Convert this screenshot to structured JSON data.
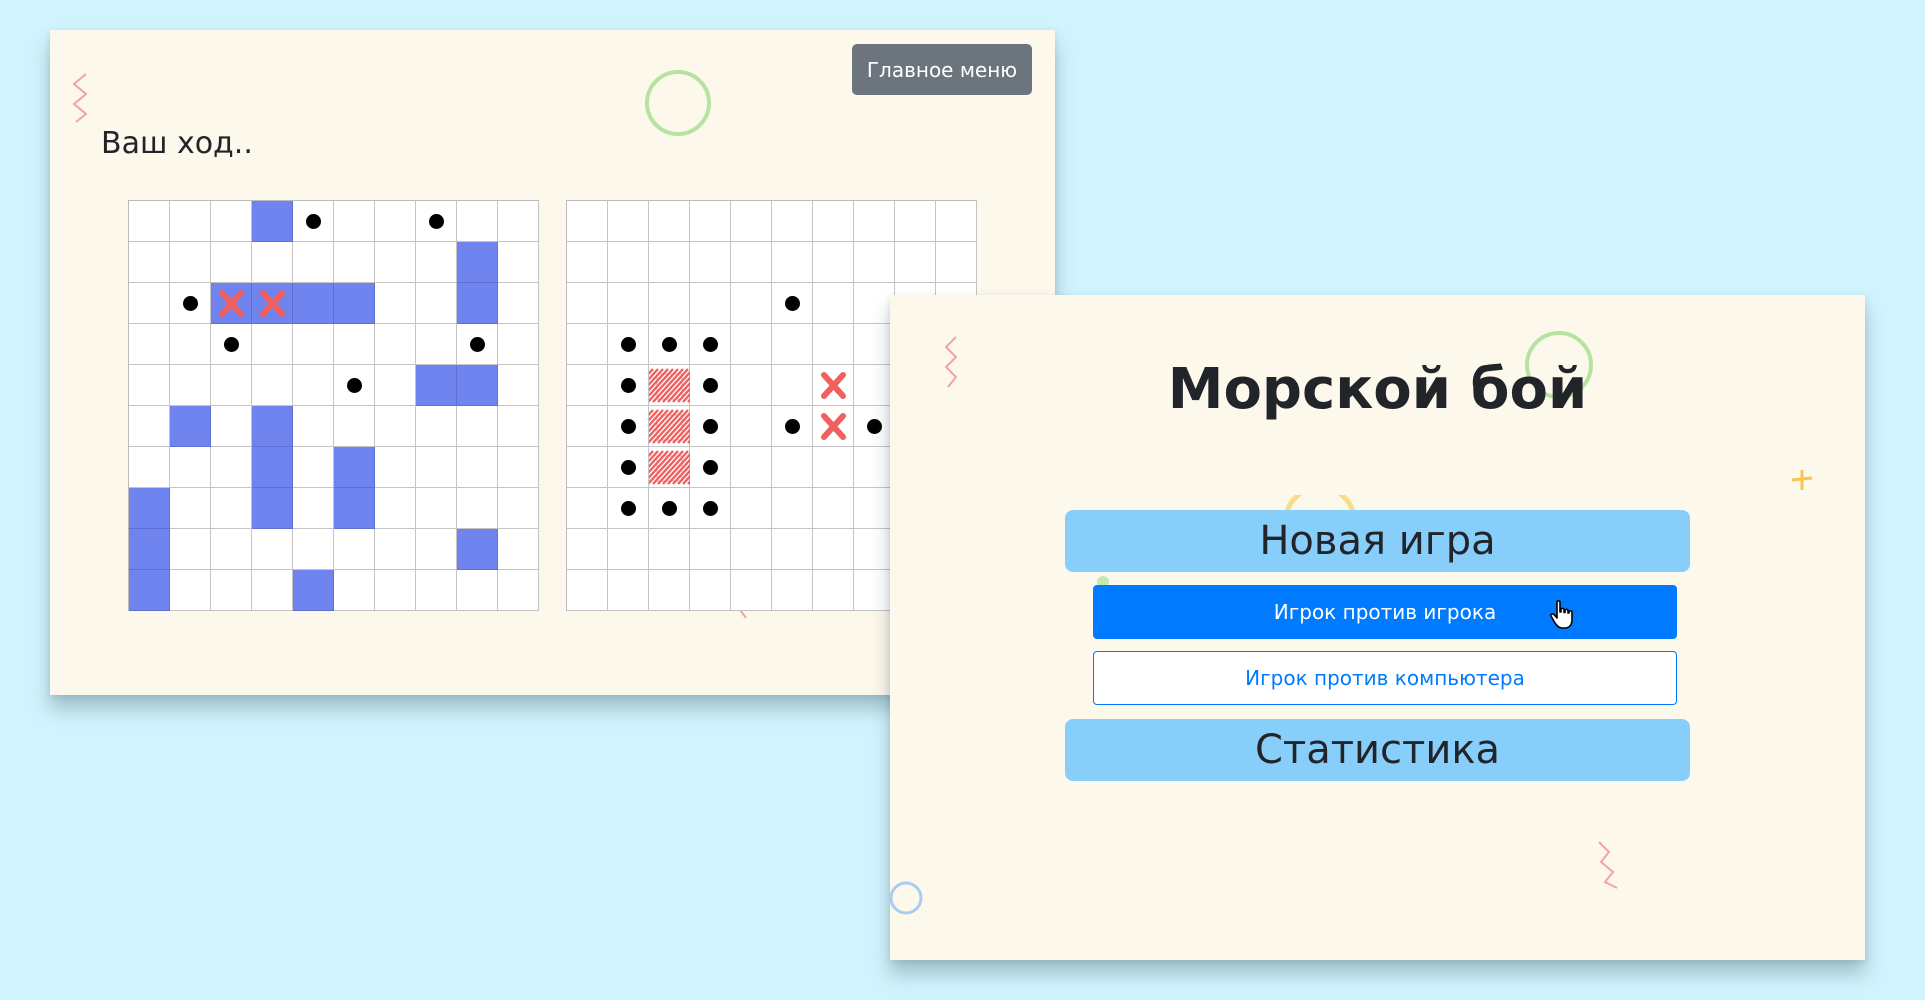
{
  "game": {
    "main_menu_label": "Главное меню",
    "turn_text": "Ваш ход..",
    "own_board": {
      "ships": [
        [
          0,
          3
        ],
        [
          1,
          8
        ],
        [
          2,
          2
        ],
        [
          2,
          3
        ],
        [
          2,
          4
        ],
        [
          2,
          5
        ],
        [
          2,
          8
        ],
        [
          4,
          7
        ],
        [
          4,
          8
        ],
        [
          5,
          1
        ],
        [
          5,
          3
        ],
        [
          6,
          3
        ],
        [
          6,
          5
        ],
        [
          7,
          0
        ],
        [
          7,
          3
        ],
        [
          7,
          5
        ],
        [
          8,
          0
        ],
        [
          8,
          8
        ],
        [
          9,
          0
        ],
        [
          9,
          4
        ]
      ],
      "misses": [
        [
          0,
          4
        ],
        [
          0,
          7
        ],
        [
          2,
          1
        ],
        [
          3,
          2
        ],
        [
          3,
          8
        ],
        [
          4,
          5
        ]
      ],
      "hits": [
        [
          2,
          2
        ],
        [
          2,
          3
        ]
      ]
    },
    "enemy_board": {
      "misses": [
        [
          2,
          5
        ],
        [
          3,
          1
        ],
        [
          3,
          2
        ],
        [
          3,
          3
        ],
        [
          4,
          1
        ],
        [
          4,
          3
        ],
        [
          5,
          1
        ],
        [
          5,
          3
        ],
        [
          5,
          5
        ],
        [
          5,
          7
        ],
        [
          6,
          1
        ],
        [
          6,
          3
        ],
        [
          7,
          1
        ],
        [
          7,
          2
        ],
        [
          7,
          3
        ]
      ],
      "hits": [
        [
          4,
          6
        ],
        [
          5,
          6
        ]
      ],
      "sunk": [
        [
          4,
          2
        ],
        [
          5,
          2
        ],
        [
          6,
          2
        ]
      ]
    },
    "colors": {
      "ship": "#6f84ee",
      "hit": "#f0605f",
      "miss": "#000000"
    }
  },
  "menu": {
    "title": "Морской бой",
    "new_game_label": "Новая игра",
    "pvp_label": "Игрок против игрока",
    "pvc_label": "Игрок против компьютера",
    "stats_label": "Статистика"
  },
  "icons": {
    "cursor": "hand-pointer-icon",
    "hit": "cross-icon",
    "sunk": "hatched-fill-icon"
  },
  "theme": {
    "background": "#d1f3fd",
    "card": "#fdf8ec",
    "primary": "#007bff",
    "secondary": "#6c757d",
    "light_blue": "#87cefa"
  }
}
